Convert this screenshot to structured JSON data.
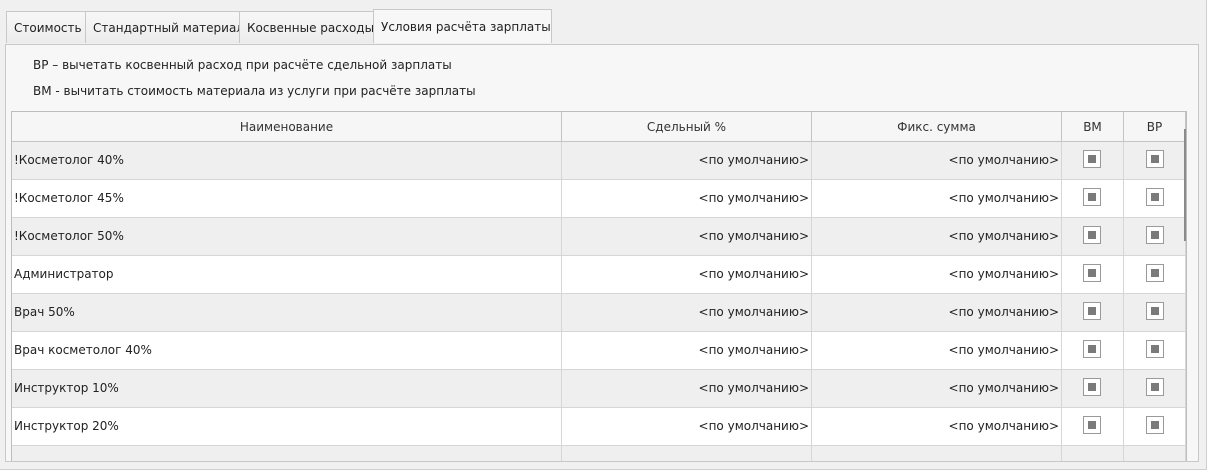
{
  "tabs": [
    {
      "label": "Стоимость",
      "active": false
    },
    {
      "label": "Стандартный материал",
      "active": false
    },
    {
      "label": "Косвенные расходы",
      "active": false
    },
    {
      "label": "Условия расчёта зарплаты",
      "active": true
    }
  ],
  "hints": {
    "vp": "ВР – вычетать косвенный расход при расчёте сдельной зарплаты",
    "vm": "ВМ - вычитать стоимость материала из услуги при расчёте зарплаты"
  },
  "table": {
    "columns": [
      "Наименование",
      "Сдельный %",
      "Фикс. сумма",
      "ВМ",
      "ВР"
    ],
    "rows": [
      {
        "name": "!Косметолог 40%",
        "piece": "<по умолчанию>",
        "fixed": "<по умолчанию>",
        "vm": "indeterminate",
        "vp": "indeterminate"
      },
      {
        "name": "!Косметолог 45%",
        "piece": "<по умолчанию>",
        "fixed": "<по умолчанию>",
        "vm": "indeterminate",
        "vp": "indeterminate"
      },
      {
        "name": "!Косметолог 50%",
        "piece": "<по умолчанию>",
        "fixed": "<по умолчанию>",
        "vm": "indeterminate",
        "vp": "indeterminate"
      },
      {
        "name": "Администратор",
        "piece": "<по умолчанию>",
        "fixed": "<по умолчанию>",
        "vm": "indeterminate",
        "vp": "indeterminate"
      },
      {
        "name": "Врач 50%",
        "piece": "<по умолчанию>",
        "fixed": "<по умолчанию>",
        "vm": "indeterminate",
        "vp": "indeterminate"
      },
      {
        "name": "Врач косметолог 40%",
        "piece": "<по умолчанию>",
        "fixed": "<по умолчанию>",
        "vm": "indeterminate",
        "vp": "indeterminate"
      },
      {
        "name": "Инструктор 10%",
        "piece": "<по умолчанию>",
        "fixed": "<по умолчанию>",
        "vm": "indeterminate",
        "vp": "indeterminate"
      },
      {
        "name": "Инструктор 20%",
        "piece": "<по умолчанию>",
        "fixed": "<по умолчанию>",
        "vm": "indeterminate",
        "vp": "indeterminate"
      },
      {
        "name": "",
        "piece": "",
        "fixed": "",
        "vm": "none",
        "vp": "none"
      }
    ]
  }
}
